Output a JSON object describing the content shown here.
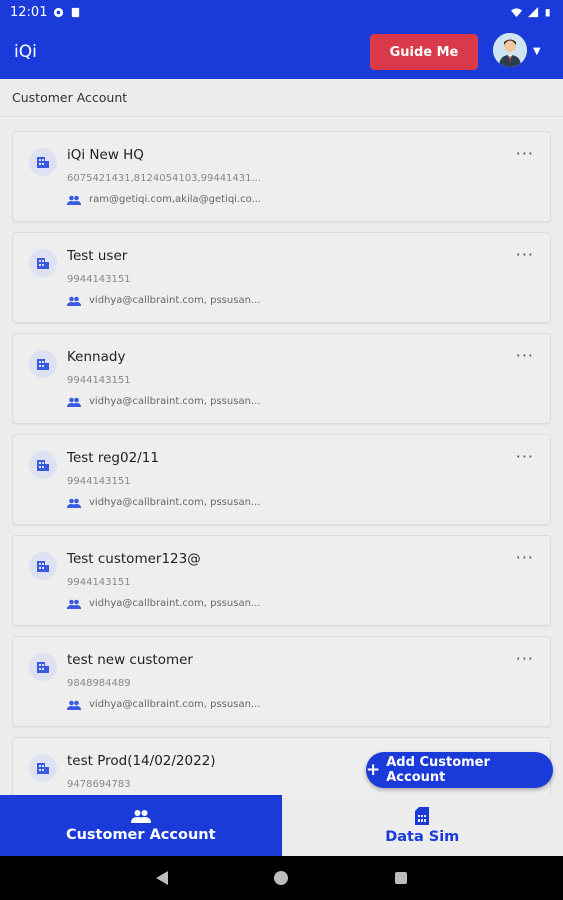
{
  "status_bar": {
    "time": "12:01",
    "icons": [
      "record-icon",
      "clipboard-icon",
      "wifi-icon",
      "signal-icon",
      "battery-icon"
    ]
  },
  "app_bar": {
    "title": "iQi",
    "guide_button_label": "Guide Me"
  },
  "subheader": {
    "title": "Customer Account"
  },
  "accounts": [
    {
      "name": "iQi New HQ",
      "phone": "6075421431,8124054103,99441431...",
      "emails": "ram@getiqi.com,akila@getiqi.co..."
    },
    {
      "name": "Test user",
      "phone": "9944143151",
      "emails": "vidhya@callbraint.com, pssusan..."
    },
    {
      "name": "Kennady",
      "phone": "9944143151",
      "emails": "vidhya@callbraint.com, pssusan..."
    },
    {
      "name": "Test reg02/11",
      "phone": "9944143151",
      "emails": "vidhya@callbraint.com, pssusan..."
    },
    {
      "name": "Test customer123@",
      "phone": "9944143151",
      "emails": "vidhya@callbraint.com, pssusan..."
    },
    {
      "name": "test new customer",
      "phone": "9848984489",
      "emails": "vidhya@callbraint.com, pssusan..."
    },
    {
      "name": "test Prod(14/02/2022)",
      "phone": "9478694783",
      "emails": ""
    }
  ],
  "fab": {
    "label": "Add Customer Account"
  },
  "bottom_nav": {
    "items": [
      {
        "label": "Customer Account",
        "active": true
      },
      {
        "label": "Data Sim",
        "active": false
      }
    ]
  },
  "colors": {
    "primary": "#1a3bd9",
    "guide_button": "#d93a4a",
    "background": "#ececec"
  }
}
